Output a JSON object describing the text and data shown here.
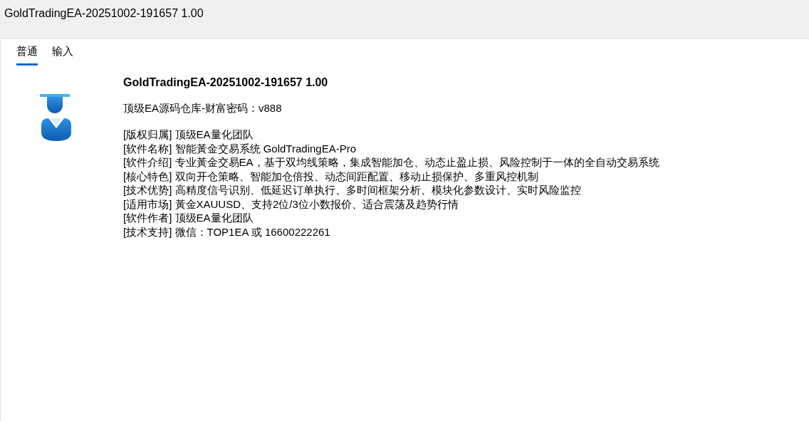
{
  "window": {
    "title": "GoldTradingEA-20251002-191657 1.00"
  },
  "tabs": [
    {
      "label": "普通",
      "selected": true
    },
    {
      "label": "输入",
      "selected": false
    }
  ],
  "info": {
    "name": "GoldTradingEA-20251002-191657 1.00",
    "subtitle": "顶级EA源码仓库-财富密码：v888",
    "lines": [
      {
        "label": "[版权归属]",
        "text": "顶级EA量化团队"
      },
      {
        "label": "[软件名称]",
        "text": "智能黃金交易系统 GoldTradingEA-Pro"
      },
      {
        "label": "[软件介绍]",
        "text": "专业黃金交易EA，基于双均线策略，集成智能加仓、动态止盈止损、风险控制于一体的全自动交易系统"
      },
      {
        "label": "[核心特色]",
        "text": "双向开仓策略、智能加仓倍投、动态间距配置、移动止损保护、多重风控机制"
      },
      {
        "label": "[技术优势]",
        "text": "高精度信号识别、低延迟订单执行、多时间框架分析、模块化参数设计、实时风险监控"
      },
      {
        "label": "[适用市场]",
        "text": "黃金XAUUSD、支持2位/3位小数报价、适合震荡及趋势行情"
      },
      {
        "label": "[软件作者]",
        "text": "顶级EA量化团队"
      },
      {
        "label": "[技术支持]",
        "text": "微信：TOP1EA 或 16600222261"
      }
    ]
  }
}
